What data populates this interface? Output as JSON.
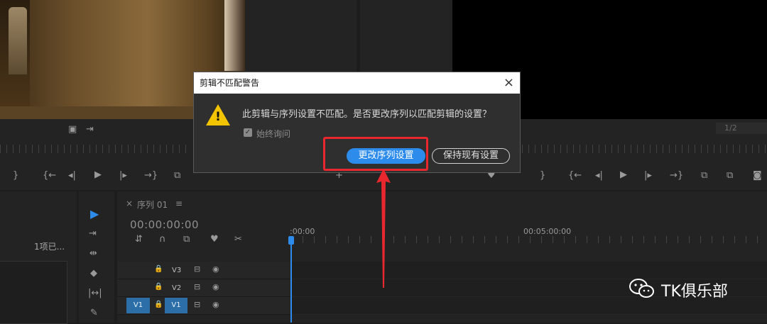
{
  "dialog": {
    "title": "剪辑不匹配警告",
    "close": "×",
    "warning_mark": "!",
    "message": "此剪辑与序列设置不匹配。是否更改序列以匹配剪辑的设置？",
    "checkbox_label": "始终询问",
    "checkbox_mark": "✓",
    "primary_button": "更改序列设置",
    "secondary_button": "保持现有设置"
  },
  "timeline": {
    "tab_close": "×",
    "tab_label": "序列 01",
    "tab_menu": "≡",
    "timecode": "00:00:00:00",
    "ruler_start": ":00:00",
    "ruler_mid": "00:05:00:00",
    "tracks": [
      {
        "name": "V3"
      },
      {
        "name": "V2"
      },
      {
        "name": "V1",
        "source": "V1"
      }
    ]
  },
  "project": {
    "items_label": "1项已..."
  },
  "monitor": {
    "page_indicator": "1/2"
  },
  "watermark": {
    "text": "TK俱乐部"
  },
  "colors": {
    "accent": "#2d8ceb",
    "highlight": "#e8282e",
    "warning": "#f2c400"
  }
}
